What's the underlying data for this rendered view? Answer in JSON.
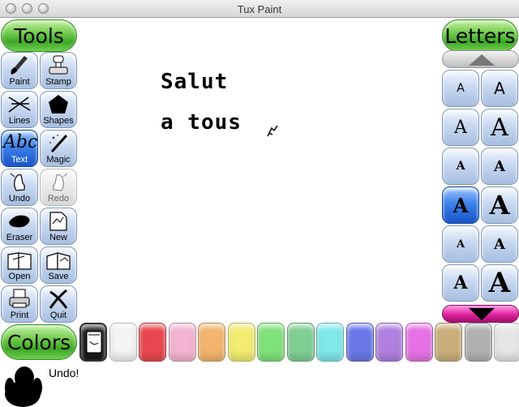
{
  "window": {
    "title": "Tux Paint"
  },
  "tools_header": "Tools",
  "letters_header": "Letters",
  "colors_header": "Colors",
  "tools": [
    {
      "label": "Paint",
      "icon": "paintbrush-icon",
      "state": "normal"
    },
    {
      "label": "Stamp",
      "icon": "stamp-icon",
      "state": "normal"
    },
    {
      "label": "Lines",
      "icon": "lines-icon",
      "state": "normal"
    },
    {
      "label": "Shapes",
      "icon": "pentagon-icon",
      "state": "normal"
    },
    {
      "label": "Text",
      "icon_text": "Abc",
      "icon": "text-icon",
      "state": "selected"
    },
    {
      "label": "Magic",
      "icon": "magic-wand-icon",
      "state": "normal"
    },
    {
      "label": "Undo",
      "icon": "undo-hand-icon",
      "state": "normal"
    },
    {
      "label": "Redo",
      "icon": "redo-hand-icon",
      "state": "disabled"
    },
    {
      "label": "Eraser",
      "icon": "eraser-icon",
      "state": "normal"
    },
    {
      "label": "New",
      "icon": "new-page-icon",
      "state": "normal"
    },
    {
      "label": "Open",
      "icon": "open-book-icon",
      "state": "normal"
    },
    {
      "label": "Save",
      "icon": "save-book-icon",
      "state": "normal"
    },
    {
      "label": "Print",
      "icon": "printer-icon",
      "state": "normal"
    },
    {
      "label": "Quit",
      "icon": "quit-x-icon",
      "state": "normal"
    }
  ],
  "canvas": {
    "lines": [
      "Salut",
      "a tous"
    ]
  },
  "fonts": [
    {
      "glyph": "A",
      "style": "sans-small",
      "selected": false
    },
    {
      "glyph": "A",
      "style": "sans-medium",
      "selected": false
    },
    {
      "glyph": "A",
      "style": "serif-thin",
      "selected": false
    },
    {
      "glyph": "A",
      "style": "serif-thin-large",
      "selected": false
    },
    {
      "glyph": "A",
      "style": "serif-bold-small",
      "selected": false
    },
    {
      "glyph": "A",
      "style": "serif-bold-medium",
      "selected": false
    },
    {
      "glyph": "A",
      "style": "serif-bold",
      "selected": true
    },
    {
      "glyph": "A",
      "style": "serif-bold-large",
      "selected": false
    },
    {
      "glyph": "A",
      "style": "serif-bold-tiny",
      "selected": false
    },
    {
      "glyph": "A",
      "style": "serif-bold-medium2",
      "selected": false
    },
    {
      "glyph": "A",
      "style": "serif-bold-2",
      "selected": false
    },
    {
      "glyph": "A",
      "style": "serif-bold-xl",
      "selected": false
    }
  ],
  "colors": [
    {
      "name": "black",
      "hex": "#1a1a1a"
    },
    {
      "name": "white",
      "hex": "#f4f4f4"
    },
    {
      "name": "red",
      "hex": "#e8474f"
    },
    {
      "name": "pink",
      "hex": "#f2b4d0"
    },
    {
      "name": "orange",
      "hex": "#f2b46e"
    },
    {
      "name": "yellow",
      "hex": "#f2ec70"
    },
    {
      "name": "light-green",
      "hex": "#7fe27a"
    },
    {
      "name": "green",
      "hex": "#7fcf93"
    },
    {
      "name": "cyan",
      "hex": "#7fe8e8"
    },
    {
      "name": "blue",
      "hex": "#6a78e8"
    },
    {
      "name": "purple",
      "hex": "#b07fe0"
    },
    {
      "name": "magenta",
      "hex": "#e672e6"
    },
    {
      "name": "tan",
      "hex": "#c9ae7a"
    },
    {
      "name": "gray",
      "hex": "#b0b0b0"
    },
    {
      "name": "light-gray",
      "hex": "#e6e6e6"
    }
  ],
  "status": {
    "message": "Undo!"
  }
}
